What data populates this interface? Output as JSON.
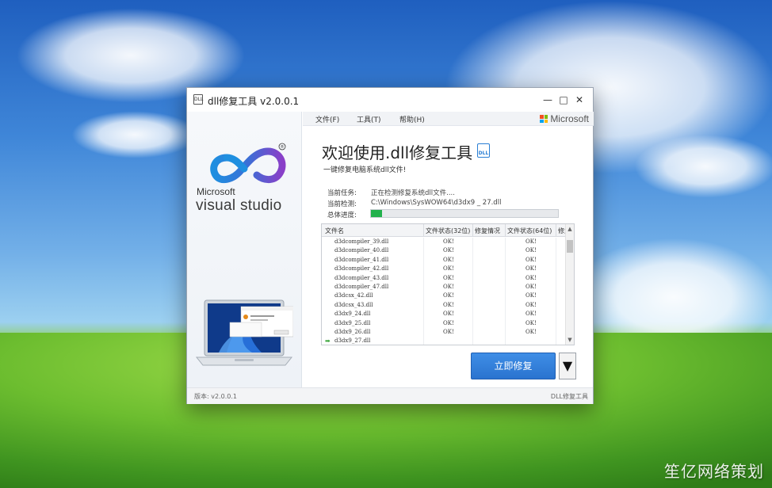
{
  "window": {
    "title": "dll修复工具 v2.0.0.1",
    "icon_text": "DLL",
    "controls": [
      "—",
      "□",
      "✕"
    ]
  },
  "left_panel": {
    "brand_small": "Microsoft",
    "brand_product": "visual studio",
    "registered": "®"
  },
  "menu": {
    "items": [
      "文件(F)",
      "工具(T)",
      "帮助(H)"
    ],
    "brand": "Microsoft"
  },
  "header": {
    "title": "欢迎使用.dll修复工具",
    "badge": "DLL",
    "subtitle": "一键修复电脑系统dll文件!"
  },
  "status": {
    "task_label": "当前任务:",
    "task_value": "正在检测修复系统dll文件....",
    "check_label": "当前检测:",
    "check_value": "C:\\Windows\\SysWOW64\\d3dx9 _ 27.dll",
    "progress_label": "总体进度:",
    "progress": 0.06
  },
  "table": {
    "headers": [
      "文件名",
      "文件状态(32位)",
      "修复情况",
      "文件状态(64位)",
      "修复情况"
    ],
    "rows": [
      {
        "name": "d3dcompiler_39.dll",
        "s32": "OK!",
        "r32": "",
        "s64": "OK!",
        "r64": ""
      },
      {
        "name": "d3dcompiler_40.dll",
        "s32": "OK!",
        "r32": "",
        "s64": "OK!",
        "r64": ""
      },
      {
        "name": "d3dcompiler_41.dll",
        "s32": "OK!",
        "r32": "",
        "s64": "OK!",
        "r64": ""
      },
      {
        "name": "d3dcompiler_42.dll",
        "s32": "OK!",
        "r32": "",
        "s64": "OK!",
        "r64": ""
      },
      {
        "name": "d3dcompiler_43.dll",
        "s32": "OK!",
        "r32": "",
        "s64": "OK!",
        "r64": ""
      },
      {
        "name": "d3dcompiler_47.dll",
        "s32": "OK!",
        "r32": "",
        "s64": "OK!",
        "r64": ""
      },
      {
        "name": "d3dcsx_42.dll",
        "s32": "OK!",
        "r32": "",
        "s64": "OK!",
        "r64": ""
      },
      {
        "name": "d3dcsx_43.dll",
        "s32": "OK!",
        "r32": "",
        "s64": "OK!",
        "r64": ""
      },
      {
        "name": "d3dx9_24.dll",
        "s32": "OK!",
        "r32": "",
        "s64": "OK!",
        "r64": ""
      },
      {
        "name": "d3dx9_25.dll",
        "s32": "OK!",
        "r32": "",
        "s64": "OK!",
        "r64": ""
      },
      {
        "name": "d3dx9_26.dll",
        "s32": "OK!",
        "r32": "",
        "s64": "OK!",
        "r64": ""
      },
      {
        "name": "d3dx9_27.dll",
        "s32": "",
        "r32": "",
        "s64": "",
        "r64": "",
        "current": true
      }
    ]
  },
  "actions": {
    "repair_label": "立即修复",
    "dropdown_glyph": "▼"
  },
  "statusbar": {
    "version": "版本: v2.0.0.1",
    "app_name": "DLL修复工具"
  },
  "desktop": {
    "watermark": "笙亿网络策划"
  },
  "colors": {
    "accent": "#2a73cf",
    "progress": "#22b14c",
    "ok_arrow": "#3aa53a"
  }
}
